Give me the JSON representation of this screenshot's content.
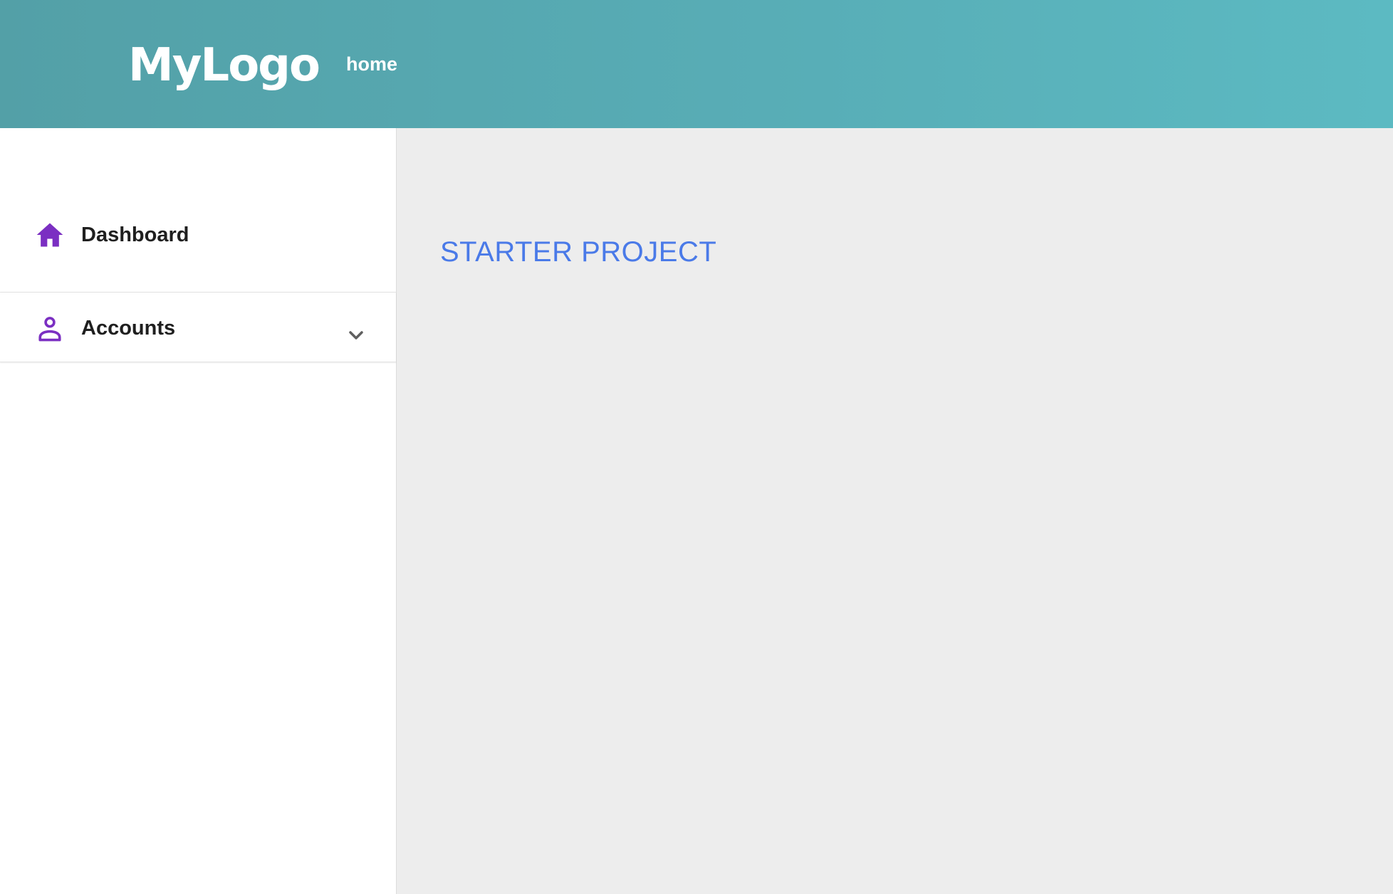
{
  "header": {
    "logo_text": "MyLogo",
    "nav_home": "home"
  },
  "sidebar": {
    "items": [
      {
        "label": "Dashboard",
        "icon": "home-icon"
      },
      {
        "label": "Accounts",
        "icon": "user-icon",
        "expandable": true,
        "expand_icon": "chevron-down-icon"
      }
    ]
  },
  "main": {
    "title": "STARTER PROJECT"
  },
  "colors": {
    "header_start": "#53a0a7",
    "header_end": "#5cbac2",
    "icon_accent": "#7b2fc2",
    "title": "#4a7ae8",
    "content_bg": "#ededed"
  }
}
